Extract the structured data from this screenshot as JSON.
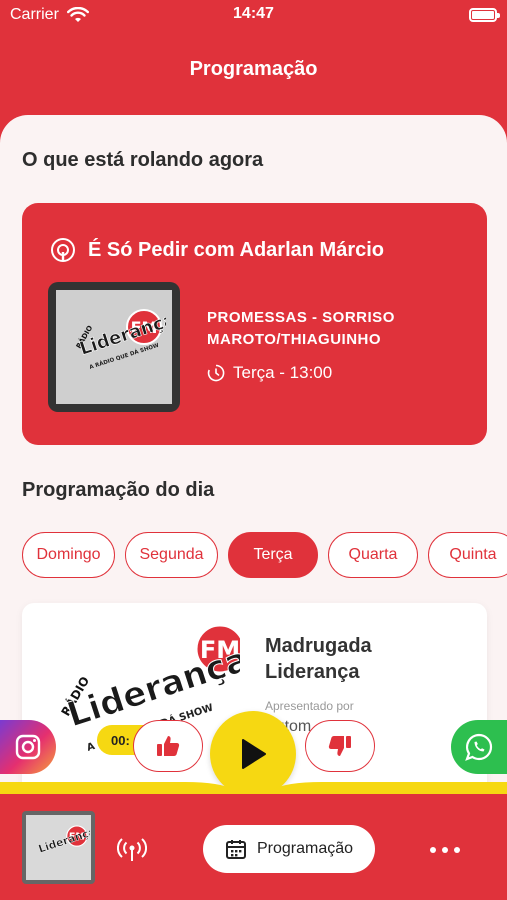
{
  "status_bar": {
    "carrier": "Carrier",
    "time": "14:47"
  },
  "header": {
    "title": "Programação"
  },
  "now_playing": {
    "heading": "O que está rolando agora",
    "show_title": "É Só Pedir com Adarlan Márcio",
    "track": "PROMESSAS - SORRISO MAROTO/THIAGUINHO",
    "schedule": "Terça - 13:00"
  },
  "logo": {
    "top_text": "RÁDIO",
    "main_text": "Liderança",
    "badge": "FM",
    "slogan": "A RÁDIO QUE DÁ SHOW"
  },
  "day_schedule": {
    "heading": "Programação do dia",
    "days": [
      "Domingo",
      "Segunda",
      "Terça",
      "Quarta",
      "Quinta"
    ],
    "active_day": "Terça"
  },
  "program_card": {
    "title": "Madrugada Liderança",
    "presenter_label": "Apresentado por",
    "presenter_name": "Autom"
  },
  "player": {
    "timer": "00:"
  },
  "bottom_bar": {
    "schedule_label": "Programação"
  },
  "colors": {
    "brand_red": "#e0323b",
    "accent_yellow": "#f6d812",
    "whatsapp_green": "#2dbf4f"
  },
  "icons": [
    "wifi-icon",
    "battery-icon",
    "radio-signal-icon",
    "clock-icon",
    "instagram-icon",
    "whatsapp-icon",
    "thumbs-up-icon",
    "thumbs-down-icon",
    "play-icon",
    "broadcast-icon",
    "calendar-icon",
    "more-icon"
  ]
}
